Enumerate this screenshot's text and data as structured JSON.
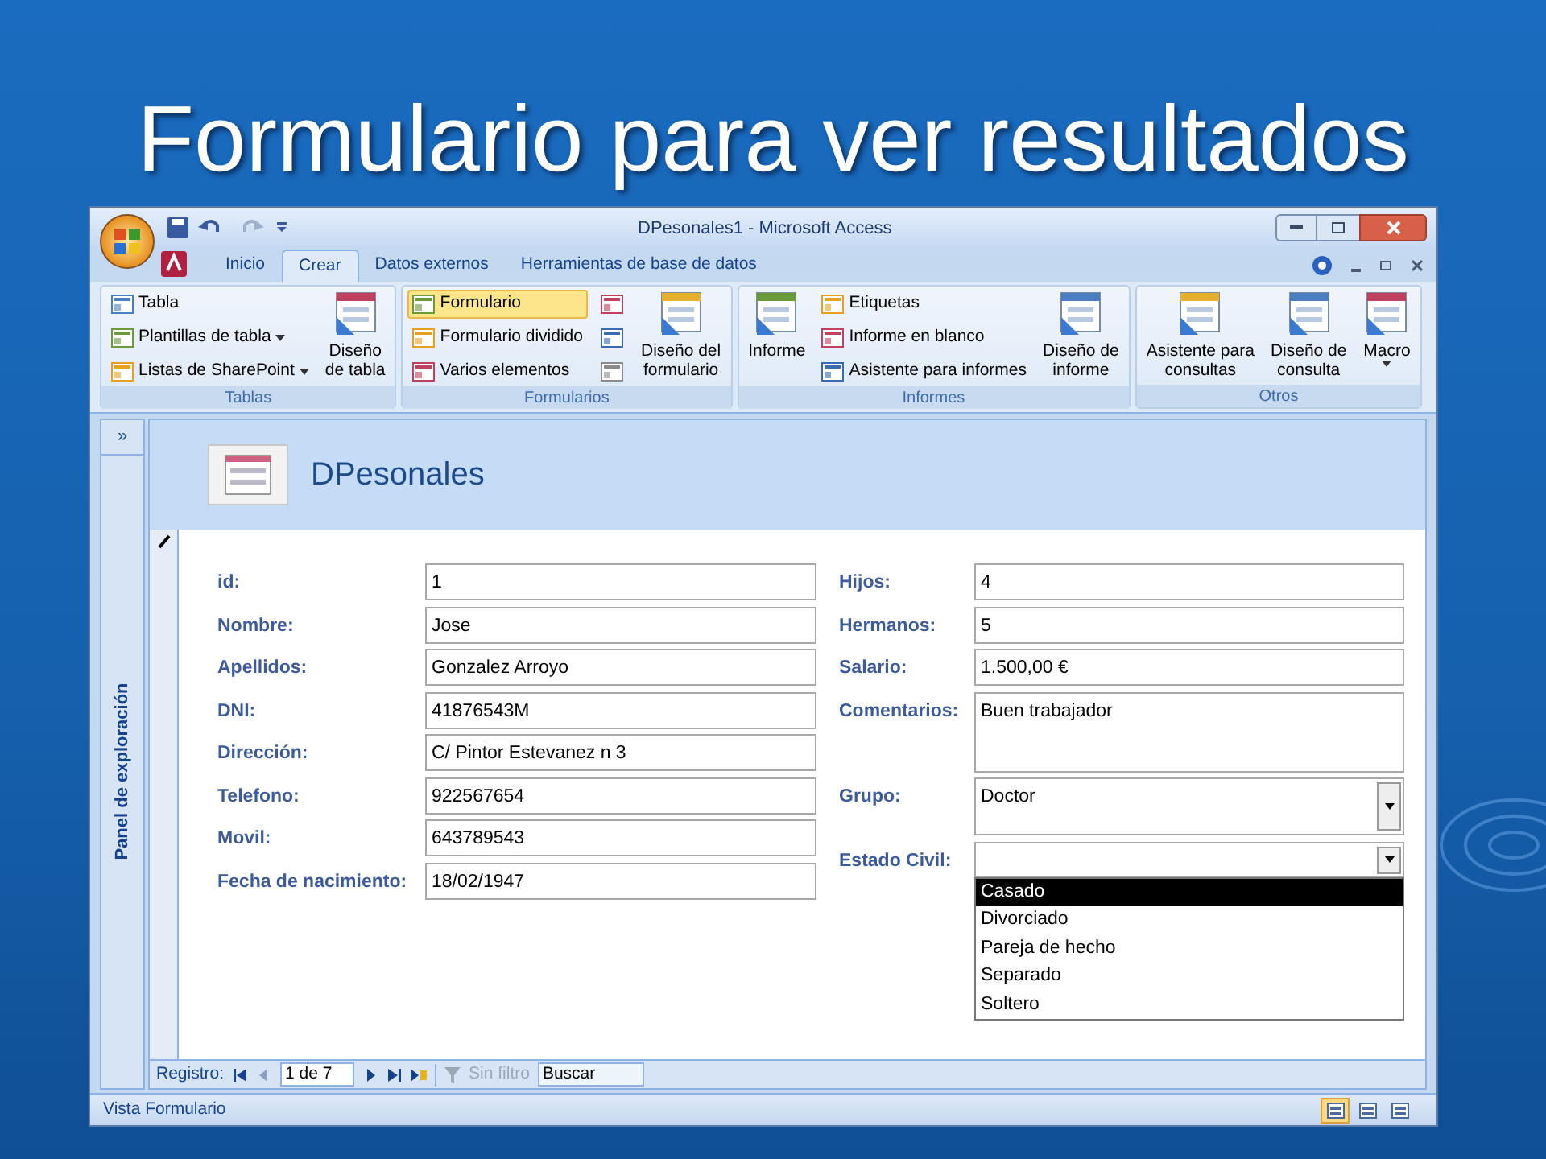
{
  "slide_title": "Formulario para ver resultados",
  "window": {
    "title": "DPesonales1 - Microsoft Access"
  },
  "tabs": [
    {
      "label": "Inicio",
      "selected": false
    },
    {
      "label": "Crear",
      "selected": true
    },
    {
      "label": "Datos externos",
      "selected": false
    },
    {
      "label": "Herramientas de base de datos",
      "selected": false
    }
  ],
  "ribbon_groups": [
    {
      "label": "Tablas",
      "columns": [
        {
          "kind": "small",
          "items": [
            {
              "label": "Tabla",
              "dropdown": false,
              "selected": false
            },
            {
              "label": "Plantillas de tabla",
              "dropdown": true,
              "selected": false
            },
            {
              "label": "Listas de SharePoint",
              "dropdown": true,
              "selected": false
            }
          ]
        },
        {
          "kind": "large",
          "label": "Diseño\nde tabla",
          "dropdown": false
        }
      ]
    },
    {
      "label": "Formularios",
      "columns": [
        {
          "kind": "small",
          "items": [
            {
              "label": "Formulario",
              "dropdown": false,
              "selected": true
            },
            {
              "label": "Formulario dividido",
              "dropdown": false,
              "selected": false
            },
            {
              "label": "Varios elementos",
              "dropdown": false,
              "selected": false
            }
          ]
        },
        {
          "kind": "icons"
        },
        {
          "kind": "large",
          "label": "Diseño del\nformulario",
          "dropdown": false
        }
      ]
    },
    {
      "label": "Informes",
      "columns": [
        {
          "kind": "large",
          "label": "Informe",
          "dropdown": false
        },
        {
          "kind": "small",
          "items": [
            {
              "label": "Etiquetas",
              "dropdown": false,
              "selected": false
            },
            {
              "label": "Informe en blanco",
              "dropdown": false,
              "selected": false
            },
            {
              "label": "Asistente para informes",
              "dropdown": false,
              "selected": false
            }
          ]
        },
        {
          "kind": "large",
          "label": "Diseño de\ninforme",
          "dropdown": false
        }
      ]
    },
    {
      "label": "Otros",
      "columns": [
        {
          "kind": "large",
          "label": "Asistente para\nconsultas",
          "dropdown": false
        },
        {
          "kind": "large",
          "label": "Diseño de\nconsulta",
          "dropdown": false
        },
        {
          "kind": "large",
          "label": "Macro",
          "dropdown": true
        }
      ]
    }
  ],
  "navigation_pane": {
    "label": "Panel de exploración",
    "toggle": "»"
  },
  "form": {
    "title": "DPesonales",
    "left_fields": [
      {
        "label": "id:",
        "value": "1"
      },
      {
        "label": "Nombre:",
        "value": "Jose"
      },
      {
        "label": "Apellidos:",
        "value": "Gonzalez Arroyo"
      },
      {
        "label": "DNI:",
        "value": "41876543M"
      },
      {
        "label": "Dirección:",
        "value": "C/ Pintor Estevanez n 3"
      },
      {
        "label": "Telefono:",
        "value": "922567654"
      },
      {
        "label": "Movil:",
        "value": "643789543"
      },
      {
        "label": "Fecha de nacimiento:",
        "value": "18/02/1947"
      }
    ],
    "right_fields": [
      {
        "label": "Hijos:",
        "value": "4",
        "kind": "text"
      },
      {
        "label": "Hermanos:",
        "value": "5",
        "kind": "text"
      },
      {
        "label": "Salario:",
        "value": "1.500,00 €",
        "kind": "text"
      },
      {
        "label": "Comentarios:",
        "value": "Buen trabajador",
        "kind": "memo"
      },
      {
        "label": "Grupo:",
        "value": "Doctor",
        "kind": "combo"
      },
      {
        "label": "Estado Civil:",
        "kind": "combo",
        "open": true,
        "options": [
          {
            "label": "Casado",
            "selected": true
          },
          {
            "label": "Divorciado",
            "selected": false
          },
          {
            "label": "Pareja de hecho",
            "selected": false
          },
          {
            "label": "Separado",
            "selected": false
          },
          {
            "label": "Soltero",
            "selected": false
          }
        ]
      }
    ]
  },
  "record_navigation": {
    "label": "Registro:",
    "position": "1 de 7",
    "filter": {
      "label": "Sin filtro",
      "disabled": true
    },
    "search": {
      "placeholder": "Buscar"
    }
  },
  "status_bar": {
    "text": "Vista Formulario",
    "views": [
      {
        "selected": true
      },
      {
        "selected": false
      },
      {
        "selected": false
      }
    ]
  }
}
